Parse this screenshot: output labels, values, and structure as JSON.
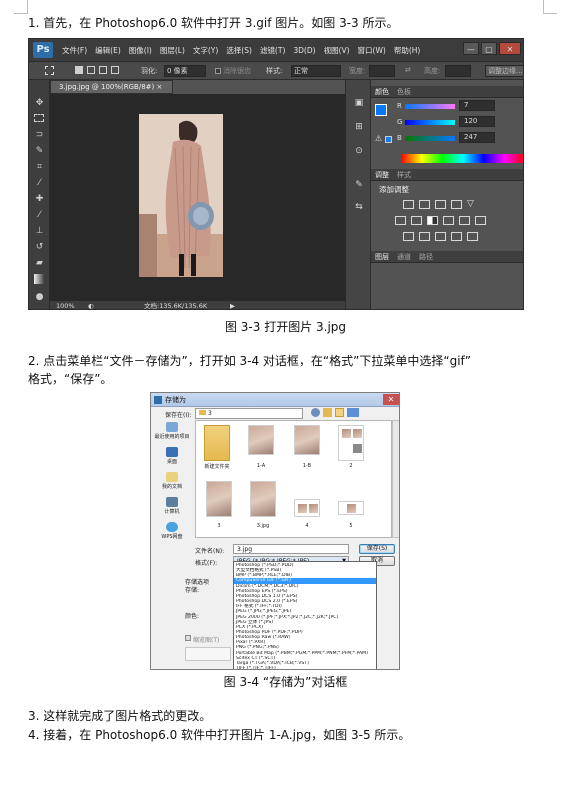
{
  "step1": {
    "text": "1. 首先，在 Photoshop6.0 软件中打开 3.gif 图片。如图 3-3 所示。"
  },
  "photoshop": {
    "logo": "Ps",
    "menu": [
      "文件(F)",
      "编辑(E)",
      "图像(I)",
      "图层(L)",
      "文字(Y)",
      "选择(S)",
      "滤镜(T)",
      "3D(D)",
      "视图(V)",
      "窗口(W)",
      "帮助(H)"
    ],
    "window_buttons": [
      "—",
      "▢",
      "✕"
    ],
    "options": {
      "feather_label": "羽化:",
      "feather_value": "0 像素",
      "antialias_label": "消除锯齿",
      "style_label": "样式:",
      "style_value": "正常",
      "width_label": "宽度:",
      "height_label": "高度:",
      "refine_edge": "调整边缘..."
    },
    "doc_tab": "3.jpg.jpg @ 100%(RGB/8#) ×",
    "status": {
      "zoom": "100%",
      "doc_info": "文档:135.6K/135.6K"
    },
    "color_panel": {
      "tabs": [
        "颜色",
        "色板"
      ],
      "channels": [
        {
          "label": "R",
          "value": "7"
        },
        {
          "label": "G",
          "value": "120"
        },
        {
          "label": "B",
          "value": "247"
        }
      ],
      "foreground": "#0778f7"
    },
    "adjust_panel": {
      "tabs": [
        "调整",
        "样式"
      ],
      "title": "添加调整"
    },
    "layers_panel": {
      "tabs": [
        "图层",
        "通道",
        "路径"
      ]
    },
    "icons": {
      "tools": [
        "move-icon",
        "marquee-icon",
        "lasso-icon",
        "quick-select-icon",
        "crop-icon",
        "eyedropper-icon",
        "healing-icon",
        "brush-icon",
        "stamp-icon",
        "history-brush-icon",
        "eraser-icon",
        "gradient-icon",
        "blur-icon"
      ]
    }
  },
  "caption1": {
    "text": "图 3-3    打开图片 3.jpg"
  },
  "step2": {
    "line1": "2. 点击菜单栏“文件－存储为”，打开如 3-4 对话框，在“格式”下拉菜单中选择“gif”",
    "line2": "格式，“保存”。"
  },
  "save_dialog": {
    "title": "存储为",
    "save_in_label": "保存在(I):",
    "save_in_value": "3",
    "nav": [
      "最近使用的项目",
      "桌面",
      "我的文档",
      "计算机",
      "WPS网盘"
    ],
    "files": [
      {
        "name": "新建文件夹",
        "kind": "folder"
      },
      {
        "name": "1-A",
        "kind": "image"
      },
      {
        "name": "1-B",
        "kind": "image"
      },
      {
        "name": "2",
        "kind": "sheet"
      },
      {
        "name": "3",
        "kind": "image"
      },
      {
        "name": "3.jpg",
        "kind": "image"
      },
      {
        "name": "4",
        "kind": "sheet"
      },
      {
        "name": "5",
        "kind": "sheet"
      }
    ],
    "filename_label": "文件名(N):",
    "filename_value": "3.jpg",
    "format_label": "格式(F):",
    "format_value": "JPEG (*.JPG;*.JPEG;*.JPE)",
    "save_button": "保存(S)",
    "cancel_button": "取消",
    "options_label": "存储选项",
    "store_label": "存储:",
    "color_label": "颜色:",
    "thumbnail_label": "缩览图(T)",
    "format_options": [
      "Photoshop (*.PSD;*.PDD)",
      "大型文档格式 (*.PSB)",
      "BMP (*.BMP;*.RLE;*.DIB)",
      "CompuServe GIF (*.GIF)",
      "Dicom (*.DCM;*.DC3;*.DIC)",
      "Photoshop EPS (*.EPS)",
      "Photoshop DCS 1.0 (*.EPS)",
      "Photoshop DCS 2.0 (*.EPS)",
      "IFF 格式 (*.IFF;*.TDI)",
      "JPEG (*.JPG;*.JPEG;*.JPE)",
      "JPEG 2000 (*.JPF;*.JPX;*.JP2;*.J2C;*.J2K;*.JPC)",
      "JPEG 立体 (*.JPS)",
      "PCX (*.PCX)",
      "Photoshop PDF (*.PDF;*.PDP)",
      "Photoshop Raw (*.RAW)",
      "Pixar (*.PXR)",
      "PNG (*.PNG;*.PNS)",
      "Portable Bit Map (*.PBM;*.PGM;*.PPM;*.PNM;*.PFM;*.PAM)",
      "Scitex CT (*.SCT)",
      "Targa (*.TGA;*.VDA;*.ICB;*.VST)",
      "TIFF (*.TIF;*.TIFF)"
    ],
    "selected_option_index": 3
  },
  "caption2": {
    "text": "图 3-4    “存储为”对话框"
  },
  "step3": {
    "text": "3. 这样就完成了图片格式的更改。"
  },
  "step4": {
    "text": "4. 接着，在 Photoshop6.0 软件中打开图片 1-A.jpg，如图 3-5 所示。"
  }
}
